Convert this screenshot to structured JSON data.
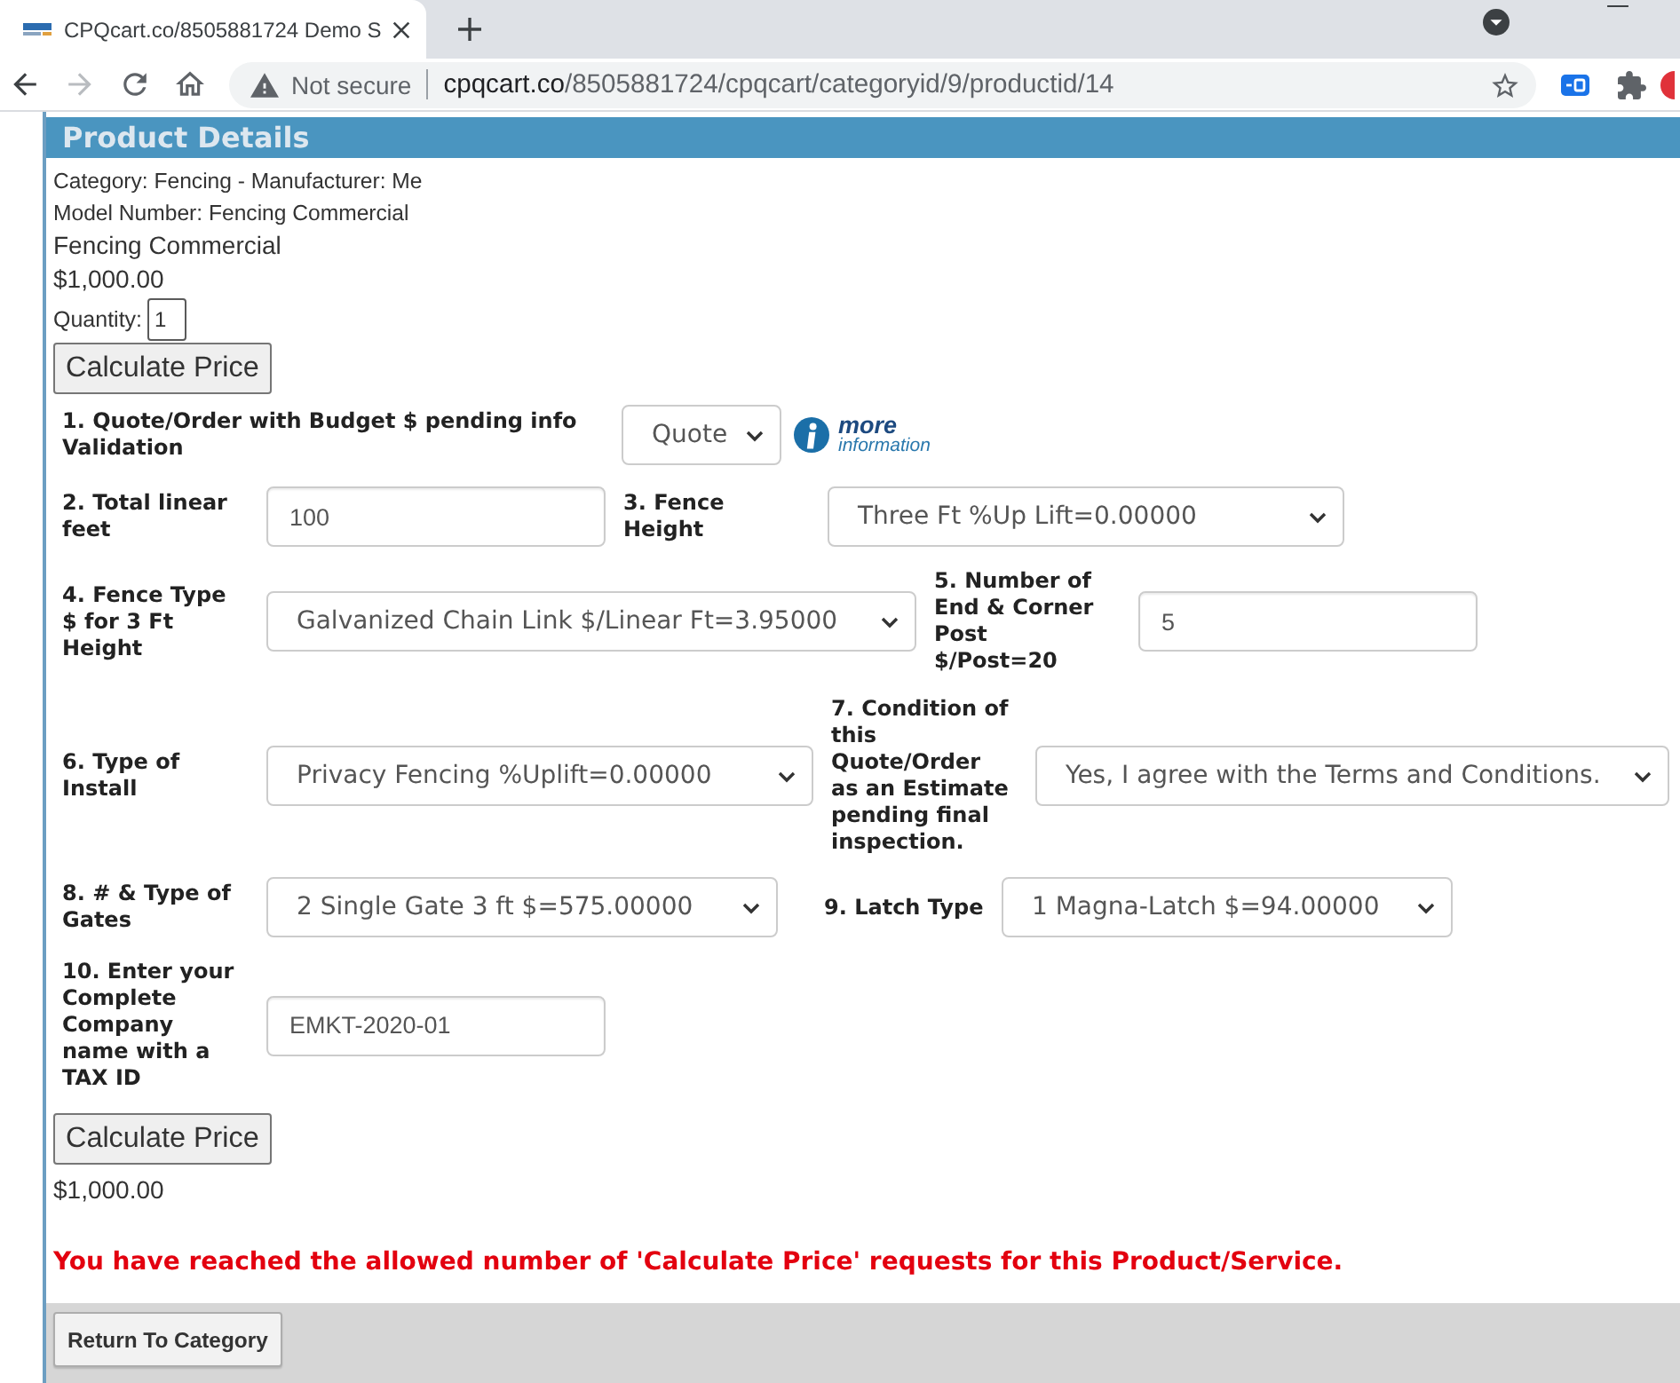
{
  "browser": {
    "tab_title": "CPQcart.co/8505881724 Demo S",
    "nav_buttons": [
      {
        "kind": "back",
        "disabled": false
      },
      {
        "kind": "forward",
        "disabled": true
      },
      {
        "kind": "reload",
        "disabled": false
      },
      {
        "kind": "home",
        "disabled": false
      }
    ],
    "address": {
      "security_label": "Not secure",
      "host": "cpqcart.co",
      "path": "/8505881724/cpqcart/categoryid/9/productid/14"
    }
  },
  "panel": {
    "title": "Product Details",
    "category_line": "Category: Fencing - Manufacturer: Me",
    "model_line": "Model Number: Fencing Commercial",
    "product_name": "Fencing Commercial",
    "price": "$1,000.00",
    "quantity": {
      "label": "Quantity:",
      "value": "1"
    },
    "calculate_button": "Calculate Price"
  },
  "form_rows": [
    {
      "fields": [
        {
          "kind": "select",
          "label": "1. Quote/Order with Budget $ pending info Validation",
          "value": "Quote",
          "info_link": {
            "title": "more",
            "subtitle": "information"
          }
        }
      ]
    },
    {
      "fields": [
        {
          "kind": "text",
          "label": "2. Total linear feet",
          "value": "100"
        },
        {
          "kind": "select",
          "label": "3. Fence Height",
          "value": "Three Ft %Up Lift=0.00000"
        }
      ]
    },
    {
      "fields": [
        {
          "kind": "select",
          "label": "4. Fence Type $ for 3 Ft Height",
          "value": "Galvanized Chain Link $/Linear Ft=3.95000"
        },
        {
          "kind": "text",
          "label": "5. Number of End & Corner Post $/Post=20",
          "value": "5"
        }
      ]
    },
    {
      "fields": [
        {
          "kind": "select",
          "label": "6. Type of Install",
          "value": "Privacy Fencing %Uplift=0.00000"
        },
        {
          "kind": "select",
          "label": "7. Condition of this Quote/Order as an Estimate pending final inspection.",
          "value": "Yes, I agree with the Terms and Conditions."
        }
      ]
    },
    {
      "fields": [
        {
          "kind": "select",
          "label": "8. # & Type of Gates",
          "value": "2 Single Gate 3 ft $=575.00000"
        },
        {
          "kind": "select",
          "label": "9. Latch Type",
          "value": "1 Magna-Latch $=94.00000"
        }
      ]
    },
    {
      "fields": [
        {
          "kind": "text",
          "label": "10. Enter your Complete Company name with a TAX ID",
          "value": "EMKT-2020-01"
        }
      ]
    }
  ],
  "result": {
    "calculate_button": "Calculate Price",
    "total": "$1,000.00",
    "limit_message": "You have reached the allowed number of 'Calculate Price' requests for this Product/Service."
  },
  "footer": {
    "return_button": "Return To Category"
  }
}
